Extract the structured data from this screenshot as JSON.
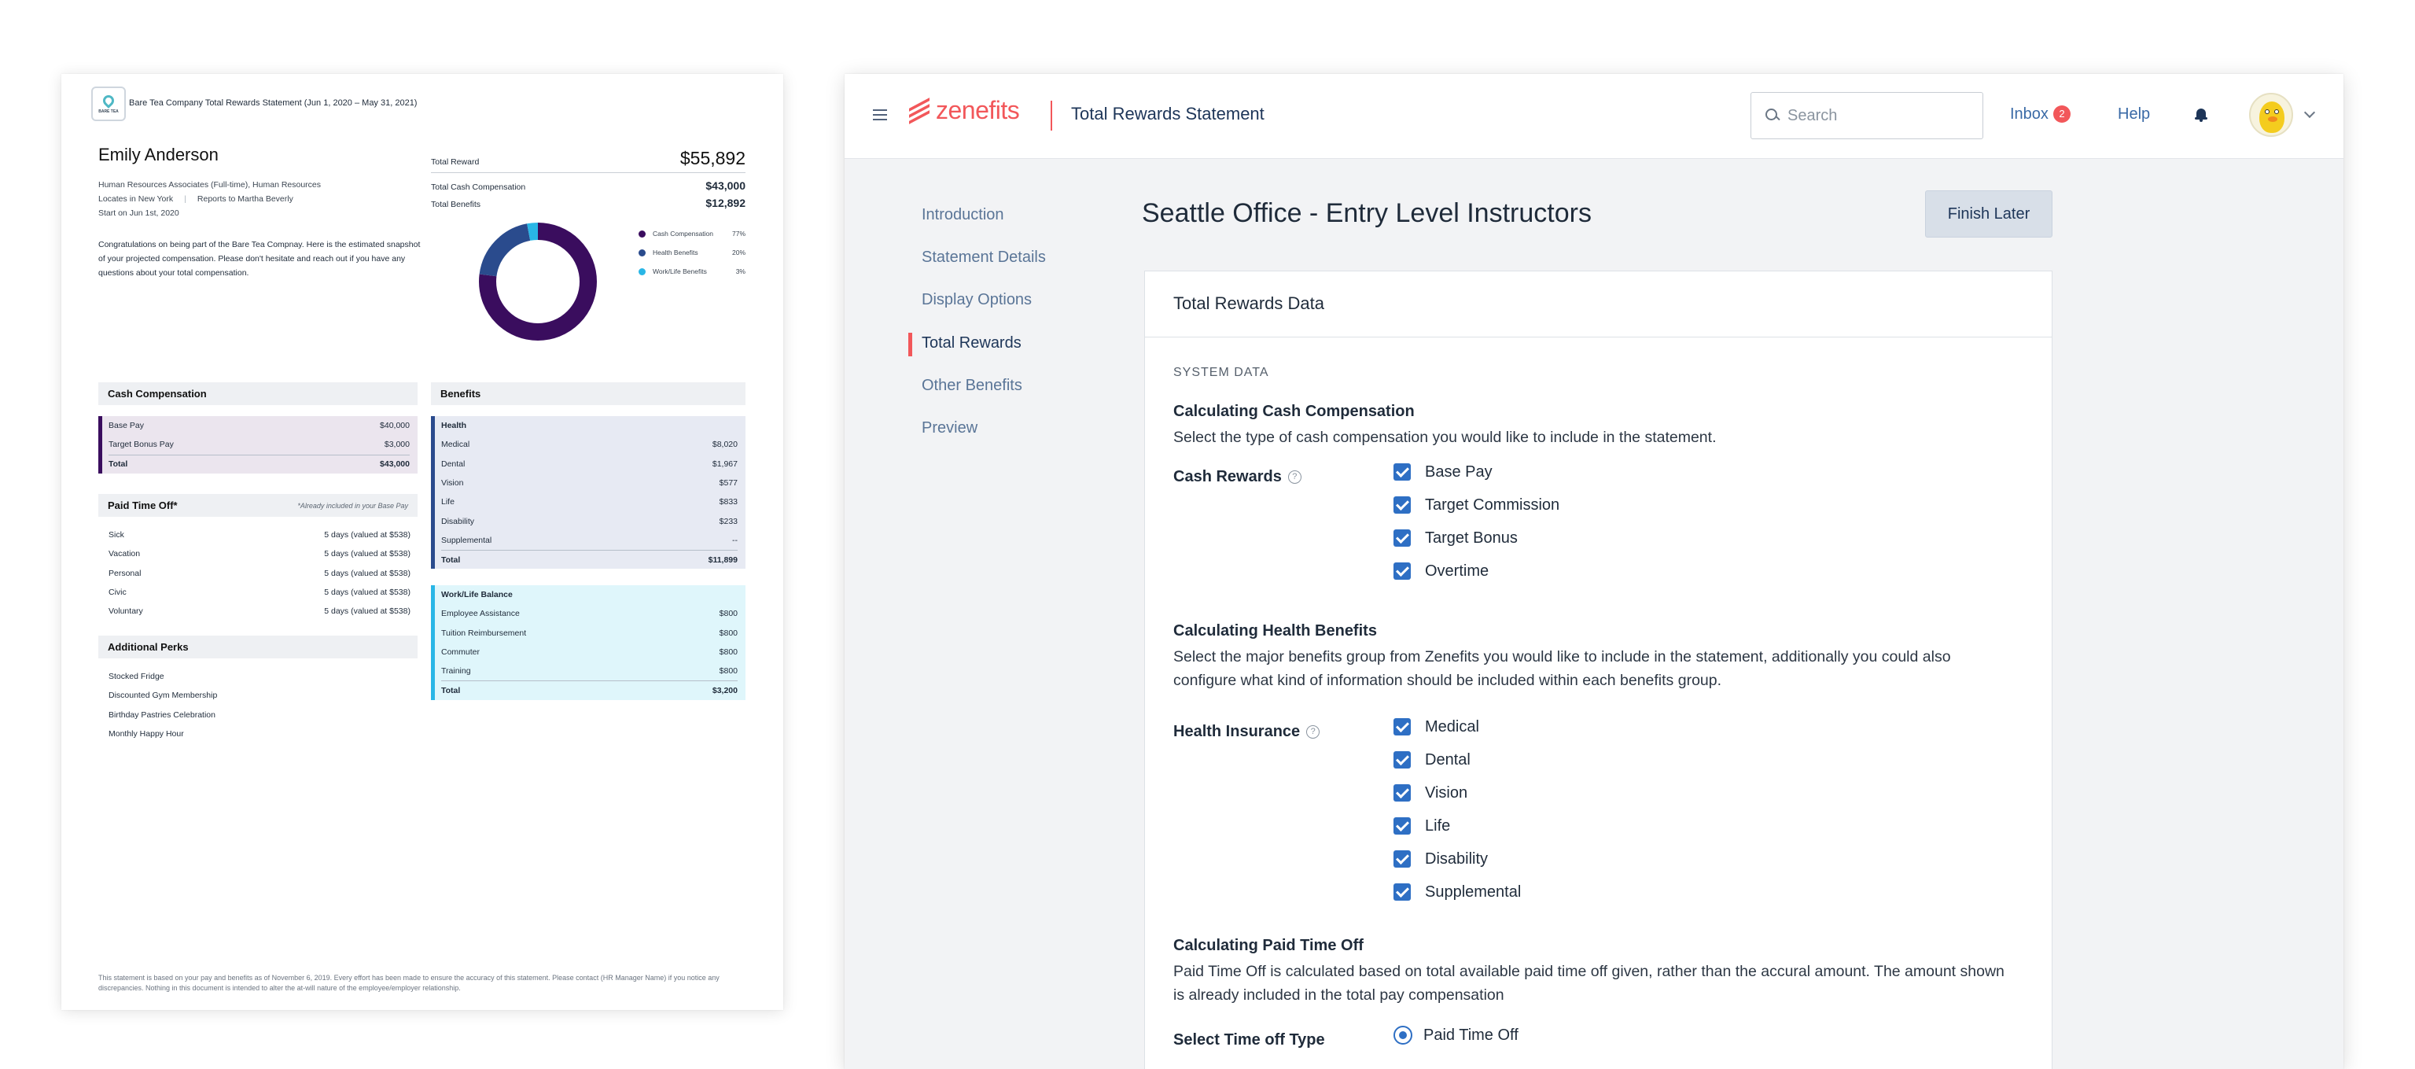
{
  "doc": {
    "logo_text": "BARE TEA",
    "header": "Bare Tea Company Total Rewards Statement (Jun 1, 2020 – May 31, 2021)",
    "employee_name": "Emily Anderson",
    "role_line": "Human Resources Associates (Full-time), Human Resources",
    "location": "Locates in New York",
    "reports_to": "Reports to Martha Beverly",
    "start_date": "Start on Jun 1st, 2020",
    "congrats": "Congratulations on being part of the Bare Tea Compnay. Here is the estimated snapshot of your projected compensation. Please don't hesitate and reach out if you have any questions about your total compensation.",
    "total_reward_label": "Total Reward",
    "total_reward_value": "$55,892",
    "total_cash_label": "Total Cash Compensation",
    "total_cash_value": "$43,000",
    "total_benefits_label": "Total Benefits",
    "total_benefits_value": "$12,892",
    "legend": [
      {
        "label": "Cash Compensation",
        "pct": "77%",
        "color": "#3a0d5e",
        "value": 77
      },
      {
        "label": "Health Benefits",
        "pct": "20%",
        "color": "#2a4b8d",
        "value": 20
      },
      {
        "label": "Work/Life Benefits",
        "pct": "3%",
        "color": "#29b6e6",
        "value": 3
      }
    ],
    "cash": {
      "title": "Cash Compensation",
      "rows": [
        {
          "label": "Base Pay",
          "value": "$40,000"
        },
        {
          "label": "Target Bonus Pay",
          "value": "$3,000"
        }
      ],
      "total_label": "Total",
      "total_value": "$43,000"
    },
    "pto": {
      "title": "Paid Time Off*",
      "note": "*Already included in your Base Pay",
      "rows": [
        {
          "label": "Sick",
          "value": "5 days (valued at $538)"
        },
        {
          "label": "Vacation",
          "value": "5 days (valued at $538)"
        },
        {
          "label": "Personal",
          "value": "5 days (valued at $538)"
        },
        {
          "label": "Civic",
          "value": "5 days (valued at $538)"
        },
        {
          "label": "Voluntary",
          "value": "5 days (valued at $538)"
        }
      ]
    },
    "perks": {
      "title": "Additional Perks",
      "items": [
        "Stocked Fridge",
        "Discounted Gym Membership",
        "Birthday Pastries Celebration",
        "Monthly Happy Hour"
      ]
    },
    "benefits": {
      "title": "Benefits",
      "health_title": "Health",
      "health_rows": [
        {
          "label": "Medical",
          "value": "$8,020"
        },
        {
          "label": "Dental",
          "value": "$1,967"
        },
        {
          "label": "Vision",
          "value": "$577"
        },
        {
          "label": "Life",
          "value": "$833"
        },
        {
          "label": "Disability",
          "value": "$233"
        },
        {
          "label": "Supplemental",
          "value": "--"
        }
      ],
      "health_total_label": "Total",
      "health_total_value": "$11,899",
      "wl_title": "Work/Life Balance",
      "wl_rows": [
        {
          "label": "Employee Assistance",
          "value": "$800"
        },
        {
          "label": "Tuition Reimbursement",
          "value": "$800"
        },
        {
          "label": "Commuter",
          "value": "$800"
        },
        {
          "label": "Training",
          "value": "$800"
        }
      ],
      "wl_total_label": "Total",
      "wl_total_value": "$3,200"
    },
    "footer": "This statement is based on your pay and benefits as of November 6, 2019. Every effort has been made to ensure the accuracy of this statement. Please contact (HR Manager Name) if you notice any discrepancies. Nothing in this document is intended to alter the at-will nature of the employee/employer relationship."
  },
  "app": {
    "logo": "zenefits",
    "title": "Total Rewards Statement",
    "search_placeholder": "Search",
    "inbox_label": "Inbox",
    "inbox_count": "2",
    "help_label": "Help",
    "sidenav": [
      "Introduction",
      "Statement Details",
      "Display Options",
      "Total Rewards",
      "Other Benefits",
      "Preview"
    ],
    "active_nav": "Total Rewards",
    "page_title": "Seattle Office - Entry Level Instructors",
    "finish_label": "Finish Later",
    "card_title": "Total Rewards Data",
    "system_data": "SYSTEM DATA",
    "cash_heading": "Calculating Cash Compensation",
    "cash_desc": "Select the type of cash compensation you would like to include in the statement.",
    "cash_label": "Cash Rewards",
    "cash_options": [
      "Base Pay",
      "Target Commission",
      "Target Bonus",
      "Overtime"
    ],
    "health_heading": "Calculating Health Benefits",
    "health_desc": "Select the major benefits group from Zenefits you would like to include in the statement, additionally you could also configure what kind of information should be included within each benefits group.",
    "health_label": "Health Insurance",
    "health_options": [
      "Medical",
      "Dental",
      "Vision",
      "Life",
      "Disability",
      "Supplemental"
    ],
    "pto_heading": "Calculating Paid Time Off",
    "pto_desc": "Paid Time Off is calculated based on total available paid time off given, rather than the accural amount. The amount shown is already included in the total pay compensation",
    "pto_label": "Select Time off Type",
    "pto_option": "Paid Time Off",
    "accent": "#f2575a",
    "checkbox_color": "#2e6fc4"
  }
}
